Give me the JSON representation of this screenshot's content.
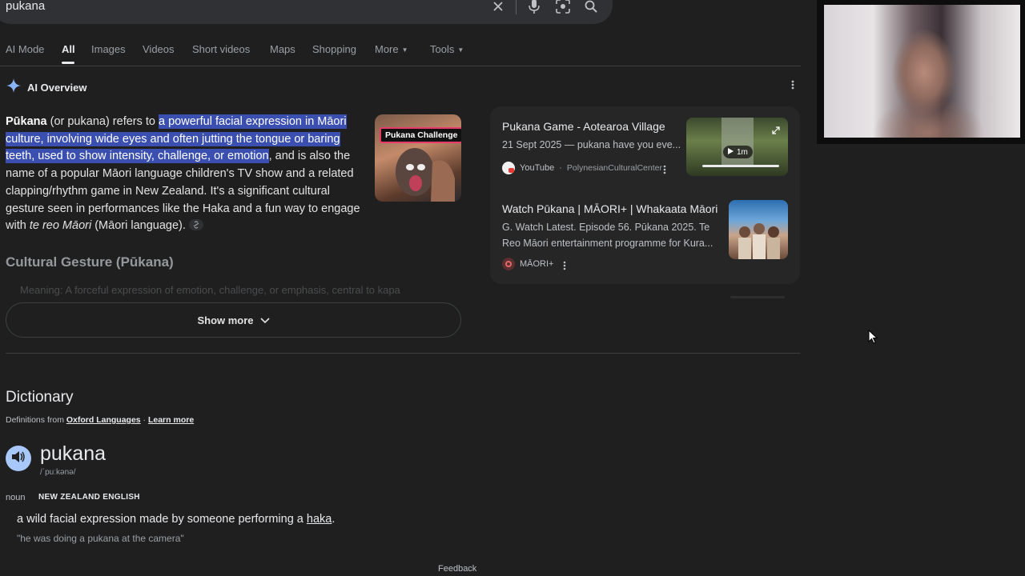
{
  "search": {
    "query": "pukana"
  },
  "tabs": [
    {
      "label": "AI Mode"
    },
    {
      "label": "All"
    },
    {
      "label": "Images"
    },
    {
      "label": "Videos"
    },
    {
      "label": "Short videos"
    },
    {
      "label": "Maps"
    },
    {
      "label": "Shopping"
    },
    {
      "label": "More"
    },
    {
      "label": "Tools"
    }
  ],
  "ai_overview": {
    "title": "AI Overview",
    "term": "Pūkana",
    "p1": " (or pukana) refers to ",
    "highlight": "a powerful facial expression in Māori culture, involving wide eyes and often jutting the tongue or baring teeth, used to show intensity, challenge, or emotion",
    "p2": ", and is also the name of a popular Māori language children's TV show and a related clapping/rhythm game in New Zealand. It's a significant cultural gesture seen in performances like the Haka and a fun way to engage with ",
    "italic": "te reo Māori",
    "p3": " (Māori language).",
    "thumb_label": "Pukana Challenge",
    "section_heading": "Cultural Gesture (Pūkana)",
    "faded_line": "Meaning: A forceful expression of emotion, challenge, or emphasis, central to kapa",
    "show_more": "Show more"
  },
  "side_results": [
    {
      "title": "Pukana Game - Aotearoa Village",
      "snippet": "21 Sept 2025 — pukana have you eve...",
      "source": "YouTube",
      "channel": "PolynesianCulturalCenter",
      "duration": "1m"
    },
    {
      "title": "Watch Pūkana | MĀORI+ | Whakaata Māori",
      "snippet": "G. Watch Latest. Episode 56. Pūkana 2025. Te Reo Māori entertainment programme for Kura...",
      "source": "MĀORI+"
    }
  ],
  "dictionary": {
    "heading": "Dictionary",
    "from_prefix": "Definitions from ",
    "oxford": "Oxford Languages",
    "sep": " · ",
    "learn_more": "Learn more",
    "word": "pukana",
    "phonetic": "/ˈpuːkənə/",
    "pos": "noun",
    "region": "NEW ZEALAND ENGLISH",
    "definition_pre": "a wild facial expression made by someone performing a ",
    "definition_link": "haka",
    "definition_post": ".",
    "example": "\"he was doing a pukana at the camera\""
  },
  "footer": {
    "feedback": "Feedback"
  },
  "colors": {
    "background": "#1f1f1f",
    "highlight": "#3a4fb0",
    "accent_blue": "#a8c7fa"
  }
}
